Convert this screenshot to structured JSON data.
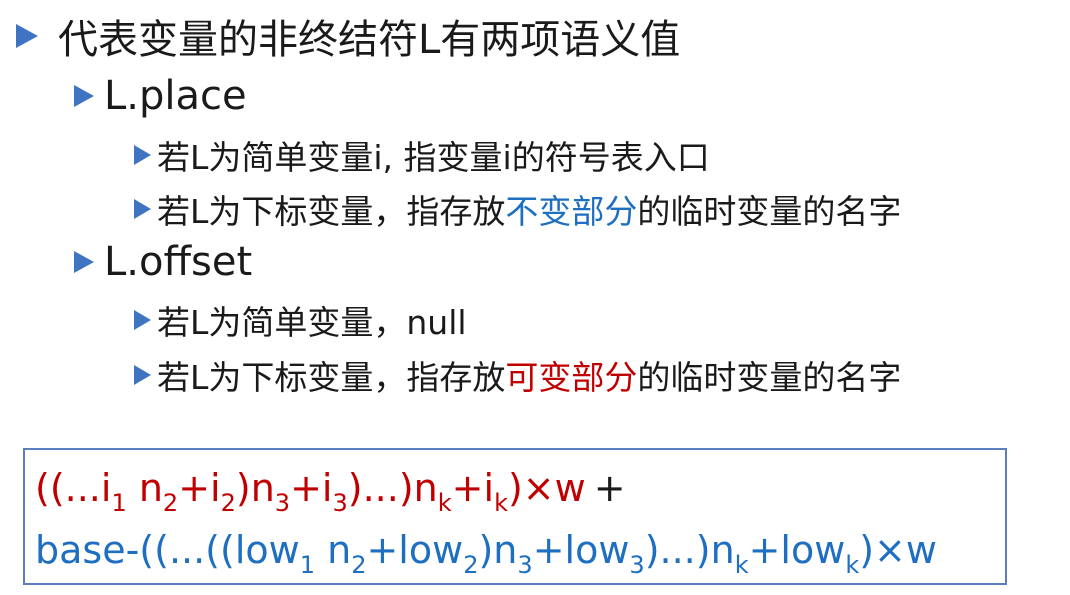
{
  "bullets": {
    "main": "代表变量的非终结符L有两项语义值",
    "place": {
      "label": "L.place",
      "item1": "若L为简单变量i, 指变量i的符号表入口",
      "item2_prefix": "若L为下标变量，指存放",
      "item2_highlight": "不变部分",
      "item2_suffix": "的临时变量的名字"
    },
    "offset": {
      "label": "L.offset",
      "item1": "若L为简单变量，null",
      "item2_prefix": "若L为下标变量，指存放",
      "item2_highlight": "可变部分",
      "item2_suffix": "的临时变量的名字"
    }
  },
  "formula": {
    "line1": {
      "t1": "((...i",
      "s1": "1",
      "t2": " n",
      "s2": "2",
      "t3": "+i",
      "s3": "2",
      "t4": ")n",
      "s4": "3",
      "t5": "+i",
      "s5": "3",
      "t6": ")...)n",
      "s6": "k",
      "t7": "+i",
      "s7": "k",
      "t8": ")×w",
      "plus": "+"
    },
    "line2": {
      "t1": "base-((...((low",
      "s1": "1",
      "t2": " n",
      "s2": "2",
      "t3": "+low",
      "s3": "2",
      "t4": ")n",
      "s4": "3",
      "t5": "+low",
      "s5": "3",
      "t6": ")...)n",
      "s6": "k",
      "t7": "+low",
      "s7": "k",
      "t8": ")×w"
    }
  },
  "colors": {
    "bullet": "#3f74c2",
    "highlight_blue": "#1e6fc1",
    "highlight_red": "#c00000",
    "box_border": "#5b7fbe"
  }
}
